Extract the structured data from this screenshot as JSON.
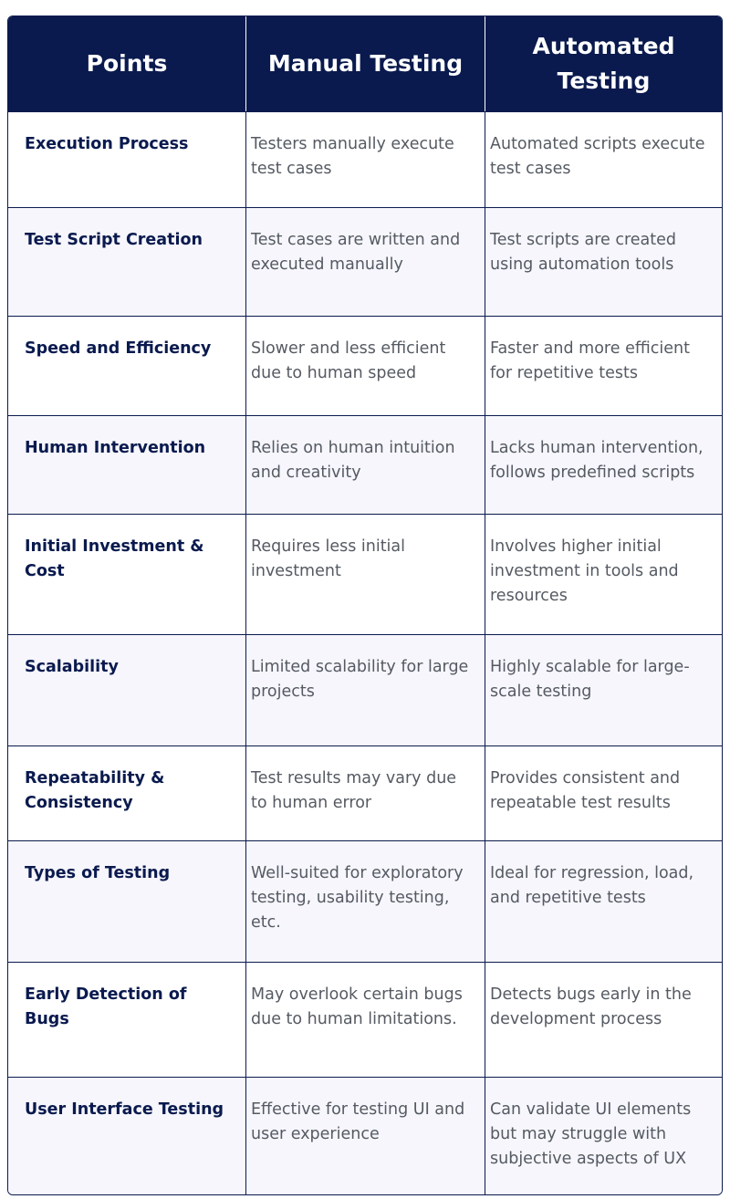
{
  "table": {
    "headers": [
      "Points",
      "Manual Testing",
      "Automated Testing"
    ],
    "rows": [
      {
        "point": "Execution Process",
        "manual": "Testers manually execute test cases",
        "automated": "Automated scripts execute test cases"
      },
      {
        "point": "Test Script Creation",
        "manual": "Test cases are written and executed manually",
        "automated": "Test scripts are created using automation tools"
      },
      {
        "point": "Speed and Efficiency",
        "manual": "Slower and less efficient due to human speed",
        "automated": "Faster and more efficient for repetitive tests"
      },
      {
        "point": "Human Intervention",
        "manual": "Relies on human intuition and creativity",
        "automated": "Lacks human intervention, follows predefined scripts"
      },
      {
        "point": "Initial Investment & Cost",
        "manual": "Requires less initial investment",
        "automated": "Involves higher initial investment in tools and resources"
      },
      {
        "point": "Scalability",
        "manual": "Limited scalability for large projects",
        "automated": "Highly scalable for large-scale testing"
      },
      {
        "point": "Repeatability & Consistency",
        "manual": "Test results may vary due to human error",
        "automated": "Provides consistent and repeatable test results"
      },
      {
        "point": "Types of Testing",
        "manual": "Well-suited for exploratory testing, usability testing, etc.",
        "automated": "Ideal for regression, load, and repetitive tests"
      },
      {
        "point": "Early Detection of Bugs",
        "manual": "May overlook certain bugs due to human limitations.",
        "automated": "Detects bugs early in the development process"
      },
      {
        "point": "User Interface Testing",
        "manual": "Effective for testing UI and user experience",
        "automated": "Can validate UI elements but may struggle with subjective aspects of UX"
      }
    ]
  },
  "colors": {
    "header_bg": "#0a1a4e",
    "alt_row_bg": "#f6f6fc",
    "point_text": "#0a1a4e",
    "body_text": "#555a62"
  }
}
